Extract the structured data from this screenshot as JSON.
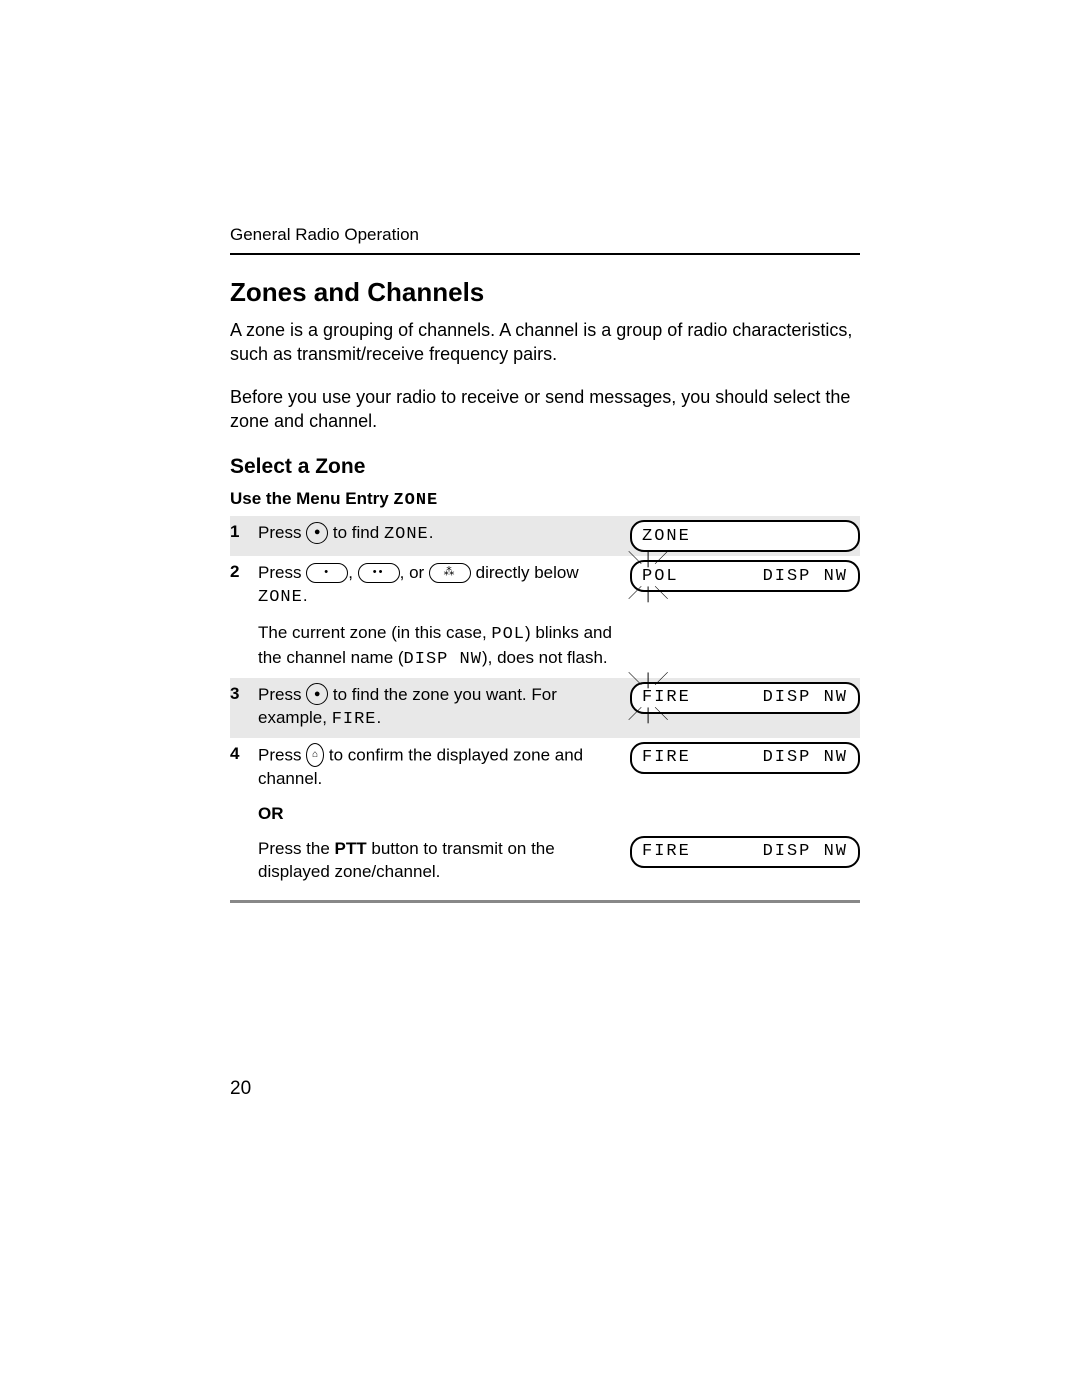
{
  "header": "General Radio Operation",
  "title": "Zones and Channels",
  "intro1": "A zone is a grouping of channels. A channel is a group of radio characteristics, such as transmit/receive frequency pairs.",
  "intro2": "Before you use your radio to receive or send messages, you should select the zone and channel.",
  "section": "Select a Zone",
  "subhead_prefix": "Use the Menu Entry ",
  "subhead_mono": "ZONE",
  "steps": {
    "s1": {
      "num": "1",
      "a": "Press ",
      "b": " to find ",
      "c": "ZONE",
      "d": "."
    },
    "s2": {
      "num": "2",
      "a": "Press ",
      "b": ", ",
      "c": ", or ",
      "d": " directly below ",
      "e": "ZONE",
      "f": ".",
      "p2a": "The current zone (in this case, ",
      "p2b": "POL",
      "p2c": ") blinks and the channel name (",
      "p2d": "DISP NW",
      "p2e": "), does not flash."
    },
    "s3": {
      "num": "3",
      "a": "Press ",
      "b": " to find the zone you want. For example, ",
      "c": "FIRE",
      "d": "."
    },
    "s4": {
      "num": "4",
      "a": "Press ",
      "b": " to confirm the displayed zone and channel."
    },
    "or": "OR",
    "s5": {
      "a": "Press the ",
      "b": "PTT",
      "c": " button to transmit on the displayed zone/channel."
    }
  },
  "lcd": {
    "zone": "ZONE",
    "pol": "POL",
    "dispnw": "DISP NW",
    "fire": "FIRE"
  },
  "pagenum": "20"
}
